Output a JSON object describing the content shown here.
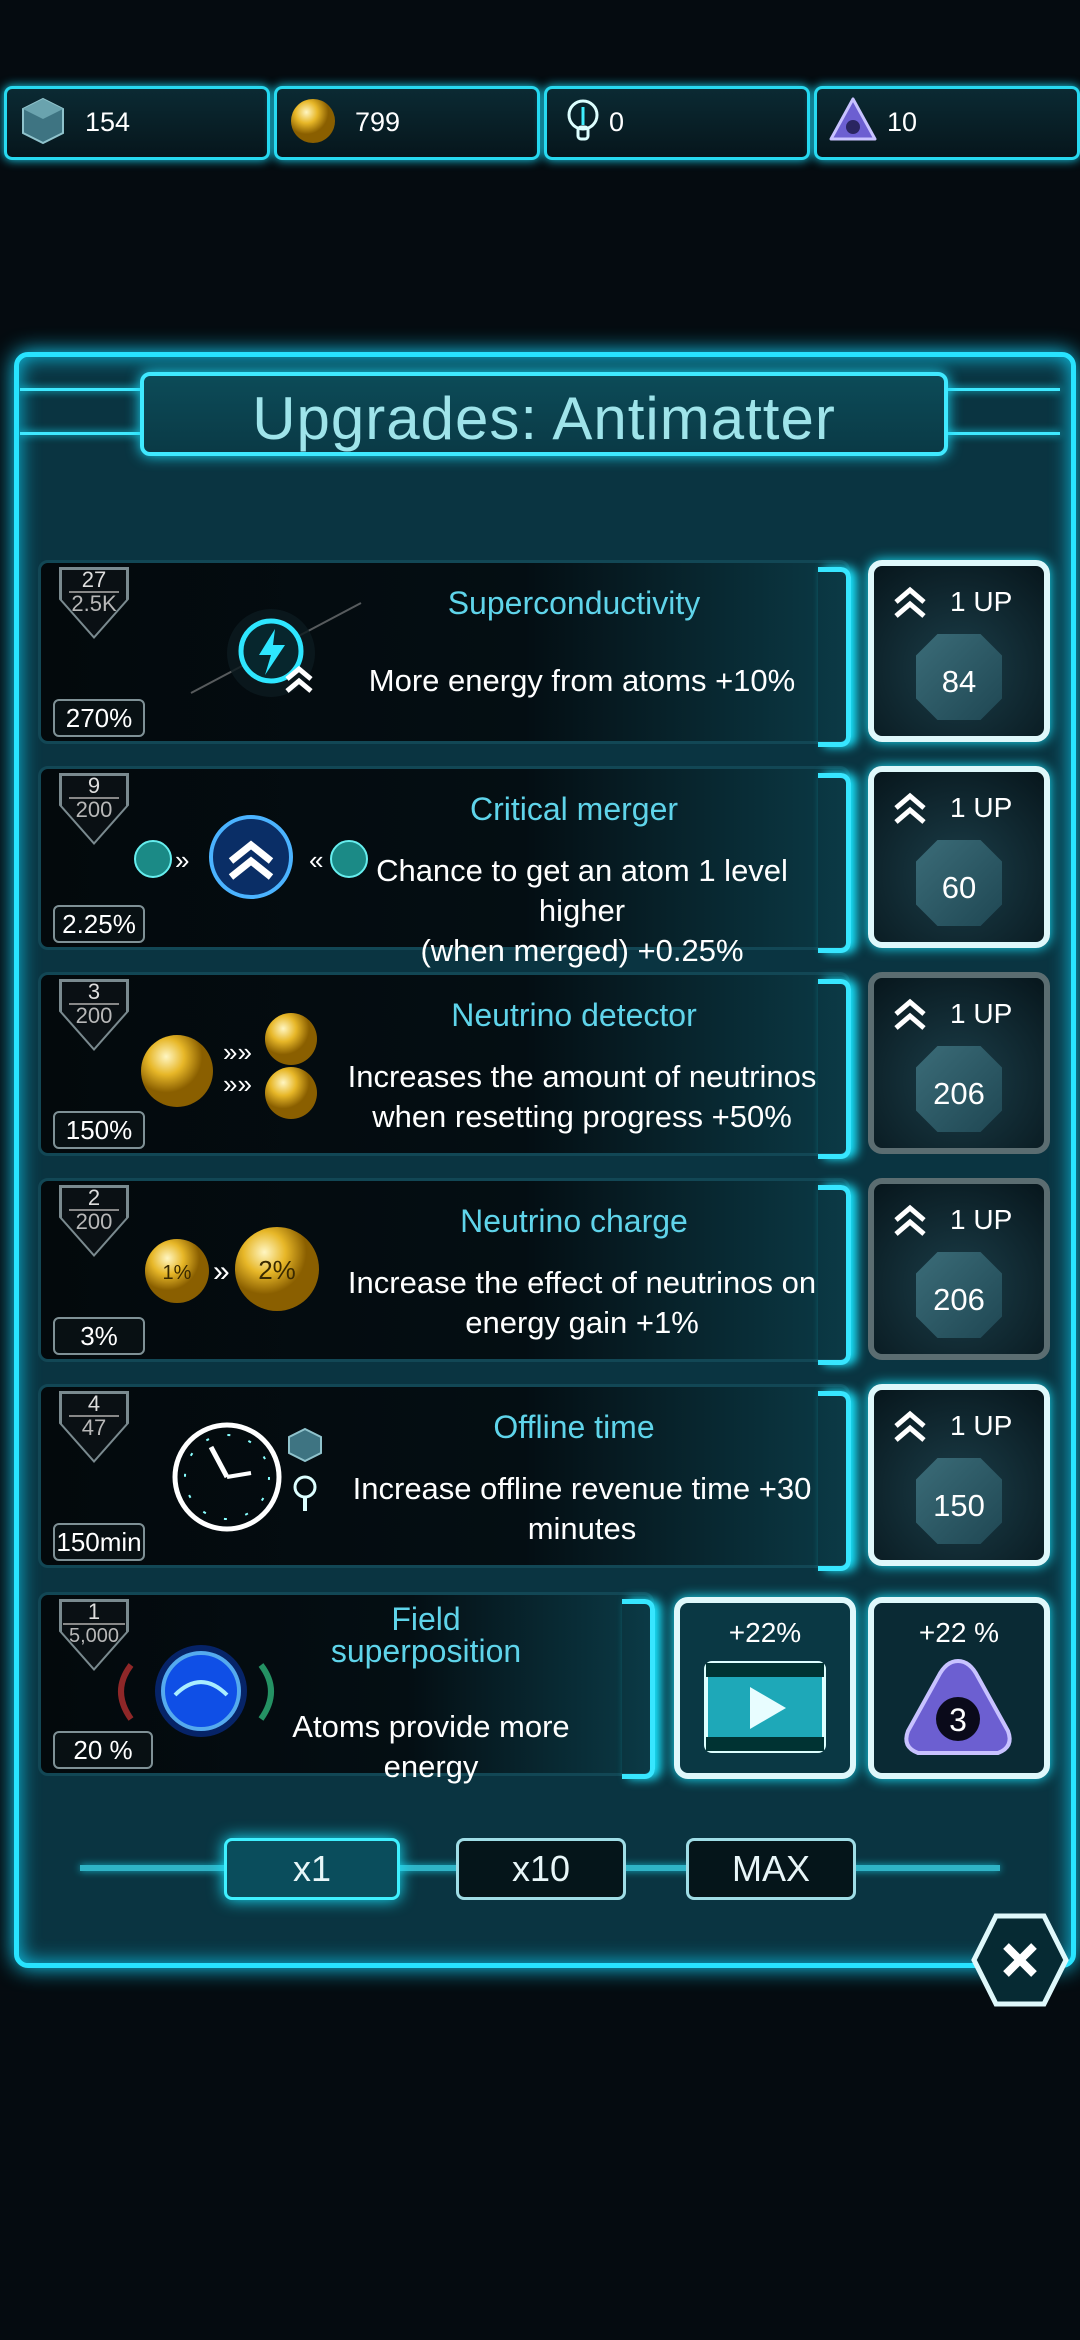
{
  "currencies": [
    {
      "icon": "antimatter-cube-icon",
      "value": "154"
    },
    {
      "icon": "gold-atom-icon",
      "value": "799"
    },
    {
      "icon": "neutrino-bulb-icon",
      "value": "0"
    },
    {
      "icon": "purple-trinity-icon",
      "value": "10"
    }
  ],
  "title": "Upgrades: Antimatter",
  "upgrades": [
    {
      "level": "27",
      "max": "2.5K",
      "percent": "270%",
      "name": "Superconductivity",
      "desc": [
        "More energy from atoms +10%"
      ],
      "buy": "1 UP",
      "cost": "84",
      "enabled": true,
      "icon": "lightning-orb-icon"
    },
    {
      "level": "9",
      "max": "200",
      "percent": "2.25%",
      "name": "Critical merger",
      "desc": [
        "Chance to get an atom 1 level higher",
        "(when merged) +0.25%"
      ],
      "buy": "1 UP",
      "cost": "60",
      "enabled": true,
      "icon": "merge-atoms-icon"
    },
    {
      "level": "3",
      "max": "200",
      "percent": "150%",
      "name": "Neutrino detector",
      "desc": [
        "Increases the amount of neutrinos",
        "when resetting progress +50%"
      ],
      "buy": "1 UP",
      "cost": "206",
      "enabled": false,
      "icon": "gold-atoms-double-icon"
    },
    {
      "level": "2",
      "max": "200",
      "percent": "3%",
      "name": "Neutrino charge",
      "desc": [
        "Increase the effect of neutrinos on",
        "energy gain +1%"
      ],
      "buy": "1 UP",
      "cost": "206",
      "enabled": false,
      "icon": "gold-atom-percent-icon",
      "small": "1%",
      "big": "2%"
    },
    {
      "level": "4",
      "max": "47",
      "percent": "150min",
      "name": "Offline time",
      "desc": [
        "Increase offline revenue time +30",
        "minutes"
      ],
      "buy": "1 UP",
      "cost": "150",
      "enabled": true,
      "icon": "clock-icon"
    }
  ],
  "special": {
    "level": "1",
    "max": "5,000",
    "percent": "20 %",
    "name": [
      "Field",
      "superposition"
    ],
    "desc": "Atoms provide more energy",
    "video_bonus": "+22%",
    "tri_bonus": "+22 %",
    "tri_count": "3"
  },
  "multipliers": [
    "x1",
    "x10",
    "MAX"
  ],
  "colors": {
    "accent": "#28e3ff",
    "panel": "#0a3441",
    "title": "#9fe4ea",
    "name": "#5fd4ea"
  }
}
